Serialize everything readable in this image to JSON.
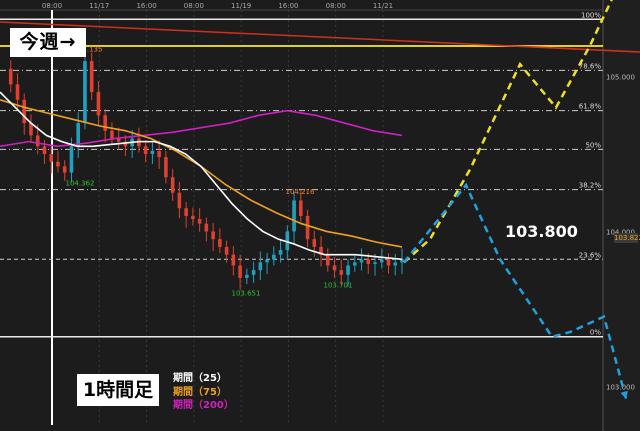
{
  "week_marker": "今週→",
  "timeframe": "1時間足",
  "legend": [
    {
      "label": "期間（25）",
      "color": "#ffffff"
    },
    {
      "label": "期間（75）",
      "color": "#f0a020"
    },
    {
      "label": "期間（200）",
      "color": "#d020c0"
    }
  ],
  "price_callout": "103.800",
  "last_price": "103.822",
  "chart_data": {
    "type": "candlestick",
    "instrument_note": "",
    "ylim": [
      102.75,
      105.43
    ],
    "x_tick_labels": [
      "08:00",
      "11/17",
      "16:00",
      "08:00",
      "11/19",
      "16:00",
      "08:00",
      "11/21"
    ],
    "y_ticks": [
      {
        "value": 105.0,
        "label": "105.000"
      },
      {
        "value": 104.0,
        "label": "104.000"
      },
      {
        "value": 103.0,
        "label": "103.000"
      }
    ],
    "fib_levels": [
      {
        "label": "100%",
        "value": 105.37
      },
      {
        "label": "78.6%",
        "value": 105.04
      },
      {
        "label": "61.8%",
        "value": 104.78
      },
      {
        "label": "50%",
        "value": 104.53
      },
      {
        "label": "38.2%",
        "value": 104.27
      },
      {
        "label": "23.6%",
        "value": 103.82
      },
      {
        "label": "0%",
        "value": 103.32
      }
    ],
    "high_low_labels": [
      {
        "text": "105.135",
        "value": 105.135,
        "kind": "high"
      },
      {
        "text": "104.362",
        "value": 104.362,
        "kind": "low"
      },
      {
        "text": "104.216",
        "value": 104.216,
        "kind": "high"
      },
      {
        "text": "103.651",
        "value": 103.651,
        "kind": "low"
      },
      {
        "text": "103.701",
        "value": 103.701,
        "kind": "low"
      }
    ],
    "close_series": [
      105.05,
      104.95,
      104.85,
      104.7,
      104.62,
      104.55,
      104.5,
      104.45,
      104.42,
      104.38,
      104.55,
      104.7,
      105.1,
      104.9,
      104.75,
      104.65,
      104.6,
      104.58,
      104.55,
      104.6,
      104.55,
      104.5,
      104.52,
      104.48,
      104.35,
      104.25,
      104.15,
      104.1,
      104.08,
      104.05,
      104.0,
      103.95,
      103.9,
      103.85,
      103.78,
      103.7,
      103.72,
      103.75,
      103.8,
      103.82,
      103.85,
      103.88,
      104.0,
      104.2,
      104.1,
      103.95,
      103.9,
      103.85,
      103.78,
      103.75,
      103.72,
      103.78,
      103.8,
      103.82,
      103.79,
      103.8,
      103.82,
      103.78,
      103.8,
      103.82
    ],
    "ma_25": [
      104.9,
      104.8,
      104.7,
      104.62,
      104.58,
      104.55,
      104.55,
      104.56,
      104.57,
      104.58,
      104.58,
      104.55,
      104.5,
      104.42,
      104.3,
      104.18,
      104.08,
      104.0,
      103.95,
      103.92,
      103.88,
      103.85,
      103.85,
      103.85,
      103.84,
      103.83,
      103.82
    ],
    "ma_75": [
      104.85,
      104.8,
      104.76,
      104.72,
      104.68,
      104.65,
      104.6,
      104.52,
      104.42,
      104.3,
      104.2,
      104.12,
      104.05,
      104.0,
      103.97,
      103.93,
      103.9
    ],
    "ma_200": [
      104.55,
      104.58,
      104.55,
      104.57,
      104.6,
      104.62,
      104.64,
      104.67,
      104.7,
      104.75,
      104.78,
      104.75,
      104.7,
      104.65,
      104.62
    ],
    "scenario_up": {
      "color": "#f0e020",
      "points": [
        103.8,
        103.95,
        104.4,
        105.08,
        104.8,
        105.2,
        105.72
      ]
    },
    "scenario_down": {
      "color": "#20a0e0",
      "points": [
        103.8,
        104.3,
        103.82,
        103.32,
        103.35,
        103.45,
        102.92
      ]
    },
    "grid": true
  }
}
